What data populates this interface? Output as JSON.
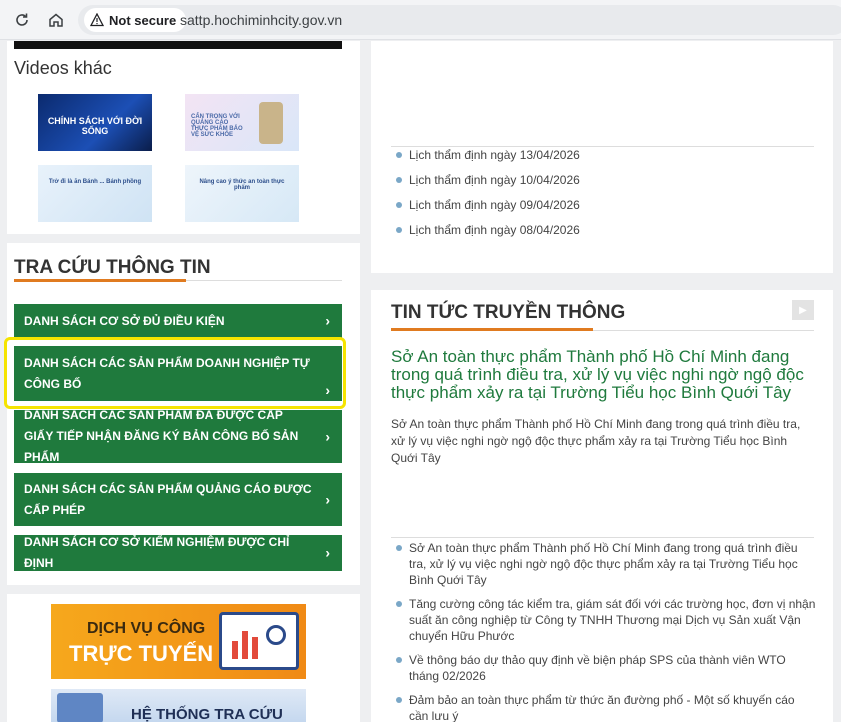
{
  "browser": {
    "security_label": "Not secure",
    "url": "sattp.hochiminhcity.gov.vn",
    "reload_icon": "reload-icon",
    "home_icon": "home-icon"
  },
  "videos": {
    "title": "Videos khác",
    "thumbs": [
      {
        "caption": "CHÍNH SÁCH VỚI ĐỜI SỐNG"
      },
      {
        "caption": "CẨN TRỌNG VỚI QUẢNG CÁO THỰC PHẨM BẢO VỆ SỨC KHỎE"
      },
      {
        "caption": "Trở đi là ăn Bánh ... Bánh phồng"
      },
      {
        "caption": "Nâng cao ý thức an toàn thực phẩm"
      }
    ]
  },
  "lookup": {
    "title": "TRA CỨU THÔNG TIN",
    "buttons": [
      {
        "label": "DANH SÁCH CƠ SỞ ĐỦ ĐIỀU KIỆN"
      },
      {
        "label": "DANH SÁCH CÁC SẢN PHẨM DOANH NGHIỆP TỰ CÔNG BỐ"
      },
      {
        "label": "DANH SÁCH CÁC SẢN PHẨM ĐÃ ĐƯỢC CẤP GIẤY TIẾP NHẬN ĐĂNG KÝ BẢN CÔNG BỐ SẢN PHẨM"
      },
      {
        "label": "DANH SÁCH CÁC SẢN PHẨM QUẢNG CÁO ĐƯỢC CẤP PHÉP"
      },
      {
        "label": "DANH SÁCH CƠ SỞ KIỂM NGHIỆM ĐƯỢC CHỈ ĐỊNH"
      }
    ],
    "chevron": "›"
  },
  "banners": {
    "service": {
      "line1": "DỊCH VỤ CÔNG",
      "line2": "TRỰC TUYẾN"
    },
    "lookup_system": {
      "line1": "HỆ THỐNG TRA CỨU"
    }
  },
  "appraisal": {
    "items": [
      {
        "text": "Lịch thẩm định ngày 13/04/2026"
      },
      {
        "text": "Lịch thẩm định ngày 10/04/2026"
      },
      {
        "text": "Lịch thẩm định ngày 09/04/2026"
      },
      {
        "text": "Lịch thẩm định ngày 08/04/2026"
      }
    ]
  },
  "news": {
    "title": "TIN TỨC TRUYỀN THÔNG",
    "more_icon": "play-icon",
    "headline": "Sở An toàn thực phẩm Thành phố Hồ Chí Minh đang trong quá trình điều tra, xử lý vụ việc nghi ngờ ngộ độc thực phẩm xảy ra tại Trường Tiểu học Bình Quới Tây",
    "summary": "Sở An toàn thực phẩm Thành phố Hồ Chí Minh đang trong quá trình điều tra, xử lý vụ việc nghi ngờ ngộ độc thực phẩm xảy ra tại Trường Tiểu học Bình Quới Tây",
    "items": [
      {
        "text": "Sở An toàn thực phẩm Thành phố Hồ Chí Minh đang trong quá trình điều tra, xử lý vụ việc nghi ngờ ngộ độc thực phẩm xảy ra tại Trường Tiểu học Bình Quới Tây"
      },
      {
        "text": "Tăng cường công tác kiểm tra, giám sát đối với các trường học, đơn vị nhận suất ăn công nghiệp từ Công ty TNHH Thương mại Dịch vụ Sản xuất Vận chuyển Hữu Phước"
      },
      {
        "text": "Về thông báo dự thảo quy định về biện pháp SPS của thành viên WTO tháng 02/2026"
      },
      {
        "text": "Đảm bảo an toàn thực phẩm từ thức ăn đường phố - Một số khuyến cáo cần lưu ý"
      }
    ]
  },
  "colors": {
    "green": "#1f7a3d",
    "orange": "#e07b20",
    "highlight": "#f5e400"
  }
}
